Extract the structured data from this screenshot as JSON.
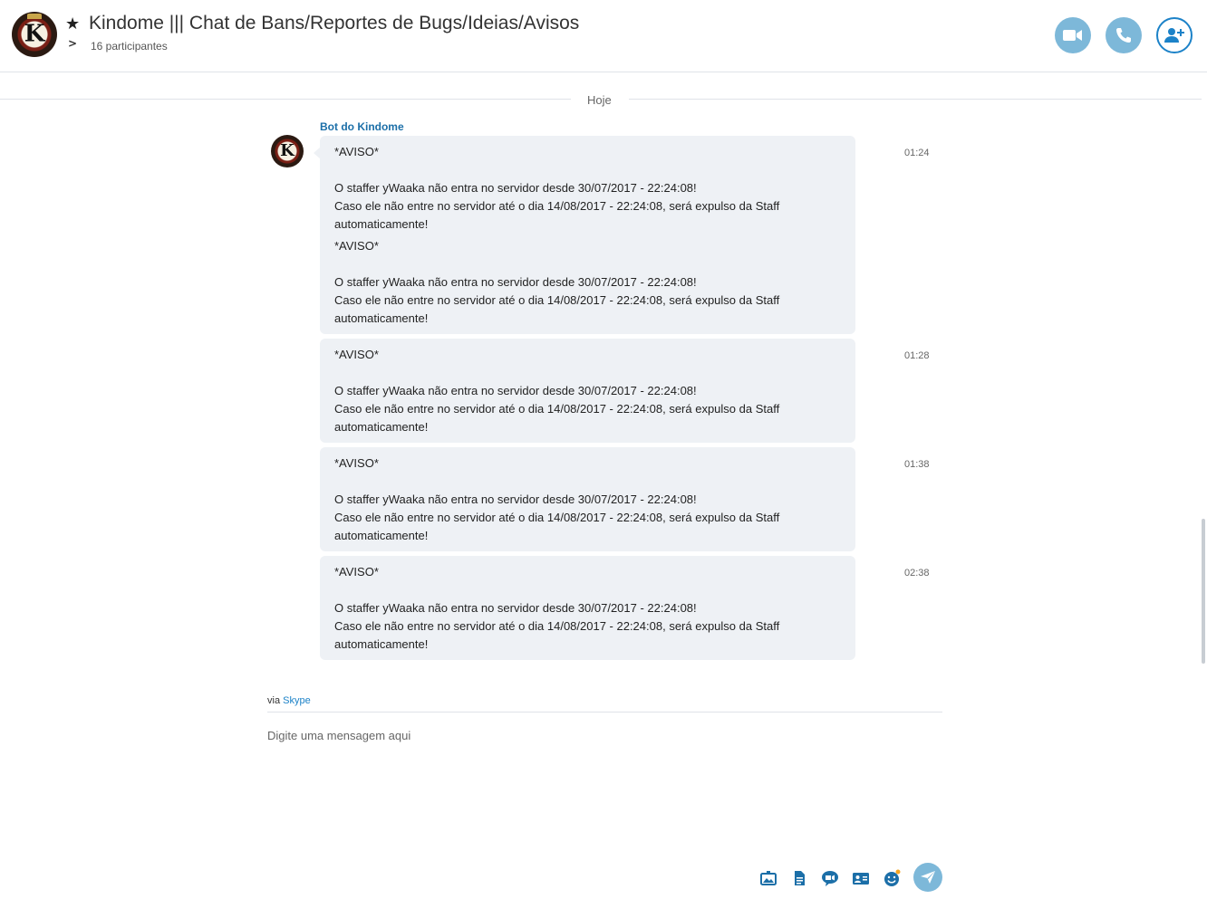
{
  "header": {
    "title": "Kindome ||| Chat de Bans/Reportes de Bugs/Ideias/Avisos",
    "participants": "16 participantes",
    "avatar_letter": "K",
    "favorite_icon": "star-icon",
    "expand_icon": "chevron-right-icon",
    "buttons": {
      "video": "video-call-icon",
      "call": "phone-call-icon",
      "add": "add-person-icon"
    }
  },
  "day_divider": "Hoje",
  "conversation": {
    "sender": "Bot do Kindome",
    "avatar_letter": "K",
    "groups": [
      {
        "time": "01:24",
        "messages": [
          "*AVISO*\n\nO staffer yWaaka não entra no servidor desde 30/07/2017 - 22:24:08!\nCaso ele não entre no servidor até o dia 14/08/2017 - 22:24:08, será expulso da Staff automaticamente!",
          "*AVISO*\n\nO staffer yWaaka não entra no servidor desde 30/07/2017 - 22:24:08!\nCaso ele não entre no servidor até o dia 14/08/2017 - 22:24:08, será expulso da Staff automaticamente!"
        ]
      },
      {
        "time": "01:28",
        "messages": [
          "*AVISO*\n\nO staffer yWaaka não entra no servidor desde 30/07/2017 - 22:24:08!\nCaso ele não entre no servidor até o dia 14/08/2017 - 22:24:08, será expulso da Staff automaticamente!"
        ]
      },
      {
        "time": "01:38",
        "messages": [
          "*AVISO*\n\nO staffer yWaaka não entra no servidor desde 30/07/2017 - 22:24:08!\nCaso ele não entre no servidor até o dia 14/08/2017 - 22:24:08, será expulso da Staff automaticamente!"
        ]
      },
      {
        "time": "02:38",
        "messages": [
          "*AVISO*\n\nO staffer yWaaka não entra no servidor desde 30/07/2017 - 22:24:08!\nCaso ele não entre no servidor até o dia 14/08/2017 - 22:24:08, será expulso da Staff automaticamente!"
        ]
      }
    ]
  },
  "compose": {
    "via_prefix": "via",
    "via_link": "Skype",
    "placeholder": "Digite uma mensagem aqui",
    "toolbar_icons": [
      "send-media-icon",
      "send-file-icon",
      "video-message-icon",
      "send-contact-icon",
      "emoticon-icon"
    ],
    "send_icon": "send-icon"
  },
  "colors": {
    "accent": "#1c82c8",
    "button_light": "#7db8d9",
    "bubble": "#eef1f5"
  }
}
